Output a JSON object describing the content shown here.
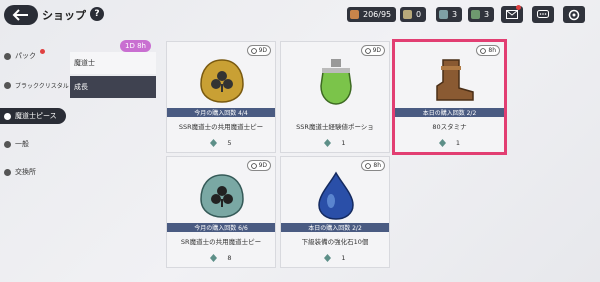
{
  "topbar": {
    "title": "ショップ",
    "help": "?",
    "resources": [
      {
        "icon": "stamina-icon",
        "value": "206/95"
      },
      {
        "icon": "gem-icon",
        "value": "0"
      },
      {
        "icon": "gem-blue-icon",
        "value": "3"
      },
      {
        "icon": "gem-green-icon",
        "value": "3"
      }
    ]
  },
  "sidebar": {
    "items": [
      {
        "label": "パック"
      },
      {
        "label": "ブラッククリスタル"
      },
      {
        "label": "魔道士ピース"
      },
      {
        "label": "一般"
      },
      {
        "label": "交換所"
      }
    ]
  },
  "subtabs": {
    "badge": "1D 8h",
    "items": [
      {
        "label": "魔道士"
      },
      {
        "label": "成長"
      }
    ]
  },
  "cards": [
    {
      "timer": "9D",
      "banner": "今月の購入回数 4/4",
      "name": "SSR魔道士の共用魔道士ピー",
      "price": "5",
      "icon": "gold-clover-emblem-icon"
    },
    {
      "timer": "9D",
      "banner": "",
      "name": "SSR魔道士経験値ポーショ",
      "price": "1",
      "icon": "green-potion-icon"
    },
    {
      "timer": "8h",
      "banner": "本日の購入回数 2/2",
      "name": "80スタミナ",
      "price": "1",
      "icon": "boot-icon"
    },
    {
      "timer": "9D",
      "banner": "今月の購入回数 6/6",
      "name": "SR魔道士の共用魔道士ピー",
      "price": "8",
      "icon": "silver-clover-emblem-icon"
    },
    {
      "timer": "8h",
      "banner": "本日の購入回数 2/2",
      "name": "下級装備の強化石10個",
      "price": "1",
      "icon": "blue-stone-icon"
    }
  ]
}
